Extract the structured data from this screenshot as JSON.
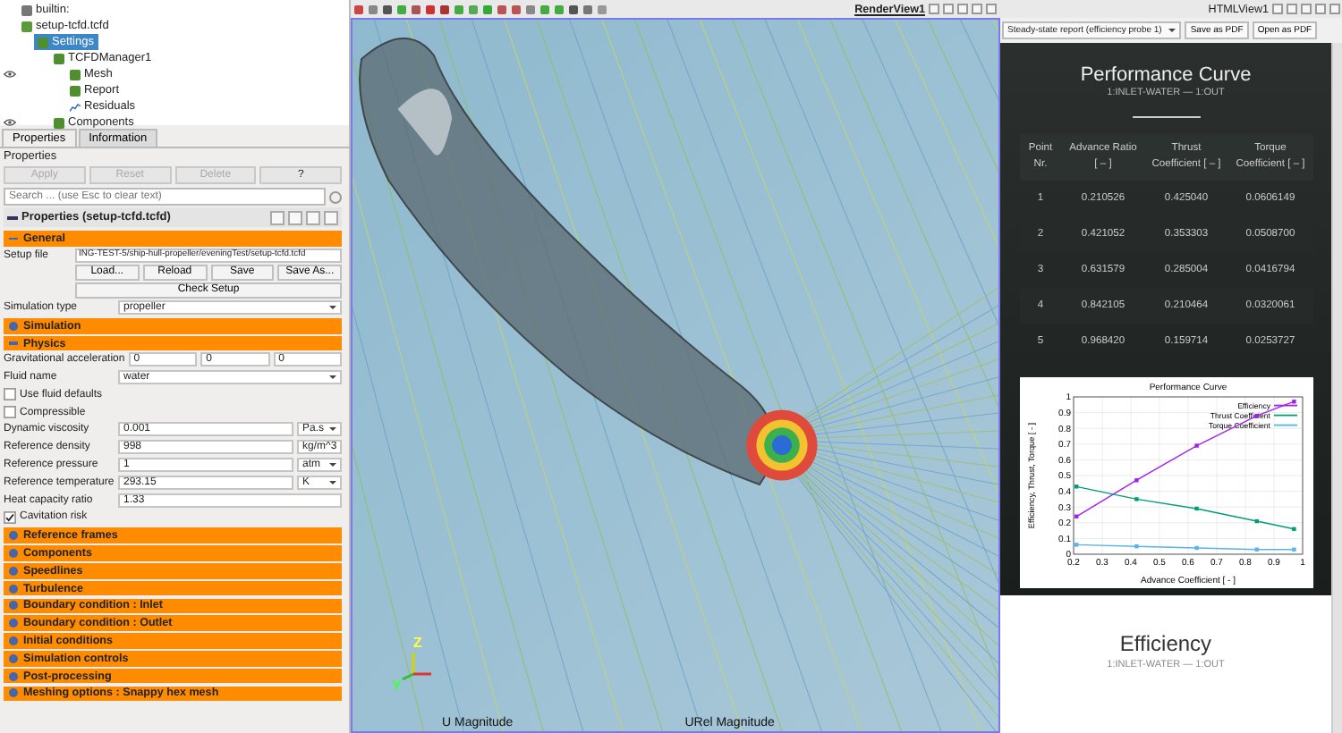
{
  "tree": {
    "items": [
      {
        "label": "builtin:",
        "kind": "server",
        "selected": false,
        "visible": false
      },
      {
        "label": "setup-tcfd.tcfd",
        "kind": "file",
        "selected": false,
        "visible": false,
        "children": [
          {
            "label": "Settings",
            "kind": "block",
            "selected": true,
            "visible": false,
            "children": [
              {
                "label": "TCFDManager1",
                "kind": "block",
                "selected": false,
                "visible": false,
                "children": [
                  {
                    "label": "Mesh",
                    "kind": "block",
                    "selected": false,
                    "visible": true
                  },
                  {
                    "label": "Report",
                    "kind": "block",
                    "selected": false,
                    "visible": false
                  },
                  {
                    "label": "Residuals",
                    "kind": "plot",
                    "selected": false,
                    "visible": false
                  }
                ]
              },
              {
                "label": "Components",
                "kind": "block",
                "selected": false,
                "visible": true
              }
            ]
          }
        ]
      }
    ]
  },
  "panel_tabs": [
    {
      "label": "Properties",
      "selected": true
    },
    {
      "label": "Information",
      "selected": false
    }
  ],
  "properties": {
    "title": "Properties",
    "buttons": [
      {
        "label": "Apply",
        "disabled": true
      },
      {
        "label": "Reset",
        "disabled": true
      },
      {
        "label": "Delete",
        "disabled": true
      },
      {
        "label": "?",
        "disabled": false
      }
    ],
    "search": {
      "placeholder": "Search ... (use Esc to clear text)"
    },
    "header": "Properties (setup-tcfd.tcfd)",
    "sections": [
      {
        "title": "General",
        "expanded": true,
        "fields": [
          {
            "kind": "path",
            "label": "Setup file",
            "value": "ING-TEST-5/ship-hull-propeller/eveningTest/setup-tcfd.tcfd"
          },
          {
            "kind": "buttons",
            "buttons": [
              "Load...",
              "Reload",
              "Save",
              "Save As..."
            ]
          },
          {
            "kind": "wide-button",
            "text": "Check Setup"
          },
          {
            "kind": "select",
            "label": "Simulation type",
            "value": "propeller"
          }
        ]
      },
      {
        "title": "Simulation",
        "expanded": false
      },
      {
        "title": "Physics",
        "expanded": true,
        "fields": [
          {
            "kind": "triple",
            "label": "Gravitational acceleration",
            "values": [
              "0",
              "0",
              "0"
            ]
          },
          {
            "kind": "select",
            "label": "Fluid name",
            "value": "water"
          },
          {
            "kind": "checkbox",
            "label": "Use fluid defaults",
            "checked": false
          },
          {
            "kind": "checkbox",
            "label": "Compressible",
            "checked": false
          },
          {
            "kind": "unit",
            "label": "Dynamic viscosity",
            "value": "0.001",
            "unit": "Pa.s"
          },
          {
            "kind": "unit",
            "label": "Reference density",
            "value": "998",
            "unit": "kg/m^3"
          },
          {
            "kind": "unit",
            "label": "Reference pressure",
            "value": "1",
            "unit": "atm"
          },
          {
            "kind": "unit",
            "label": "Reference temperature",
            "value": "293.15",
            "unit": "K"
          },
          {
            "kind": "text",
            "label": "Heat capacity ratio",
            "value": "1.33"
          },
          {
            "kind": "checkbox",
            "label": "Cavitation risk",
            "checked": true
          }
        ]
      },
      {
        "title": "Reference frames",
        "expanded": false
      },
      {
        "title": "Components",
        "expanded": false
      },
      {
        "title": "Speedlines",
        "expanded": false
      },
      {
        "title": "Turbulence",
        "expanded": false
      },
      {
        "title": "Boundary condition : Inlet",
        "expanded": false
      },
      {
        "title": "Boundary condition : Outlet",
        "expanded": false
      },
      {
        "title": "Initial conditions",
        "expanded": false
      },
      {
        "title": "Simulation controls",
        "expanded": false
      },
      {
        "title": "Post-processing",
        "expanded": false
      },
      {
        "title": "Meshing options : Snappy hex mesh",
        "expanded": false
      }
    ]
  },
  "render_view": {
    "title": "RenderView1",
    "axes": [
      "Z",
      "Y"
    ],
    "legends": [
      "U Magnitude",
      "URel Magnitude"
    ]
  },
  "html_view": {
    "title": "HTMLView1",
    "report_select": "Steady-state report (efficiency probe 1)",
    "buttons": [
      "Save as PDF",
      "Open as PDF"
    ],
    "report": {
      "title": "Performance Curve",
      "subtitle": "1:INLET-WATER — 1:OUT",
      "columns": [
        "Point Nr.",
        "Advance Ratio [ – ]",
        "Thrust Coefficient [ – ]",
        "Torque Coefficient [ – ]"
      ],
      "rows": [
        [
          "1",
          "0.210526",
          "0.425040",
          "0.0606149"
        ],
        [
          "2",
          "0.421052",
          "0.353303",
          "0.0508700"
        ],
        [
          "3",
          "0.631579",
          "0.285004",
          "0.0416794"
        ],
        [
          "4",
          "0.842105",
          "0.210464",
          "0.0320061"
        ],
        [
          "5",
          "0.968420",
          "0.159714",
          "0.0253727"
        ]
      ],
      "chart_data": {
        "type": "line",
        "title": "Performance Curve",
        "xlabel": "Advance Coefficient [ - ]",
        "ylabel": "Efficiency, Thrust, Torque [ - ]",
        "x": [
          0.21,
          0.42,
          0.63,
          0.84,
          0.97
        ],
        "series": [
          {
            "name": "Efficiency",
            "color": "#a020f0",
            "marker": "square",
            "values": [
              0.24,
              0.47,
              0.69,
              0.88,
              0.97
            ]
          },
          {
            "name": "Thrust Coefficient",
            "color": "#009e73",
            "marker": "square",
            "values": [
              0.43,
              0.35,
              0.29,
              0.21,
              0.16
            ]
          },
          {
            "name": "Torque Coefficient",
            "color": "#56b4e9",
            "marker": "square",
            "values": [
              0.06,
              0.05,
              0.04,
              0.03,
              0.03
            ]
          }
        ],
        "xlim": [
          0.2,
          1
        ],
        "ylim": [
          0,
          1
        ],
        "xticks": [
          0.2,
          0.3,
          0.4,
          0.5,
          0.6,
          0.7,
          0.8,
          0.9,
          1
        ],
        "yticks": [
          0,
          0.1,
          0.2,
          0.3,
          0.4,
          0.5,
          0.6,
          0.7,
          0.8,
          0.9,
          1
        ],
        "grid": true,
        "legend": "upper right"
      }
    },
    "next_section": {
      "title": "Efficiency",
      "subtitle": "1:INLET-WATER — 1:OUT"
    }
  }
}
